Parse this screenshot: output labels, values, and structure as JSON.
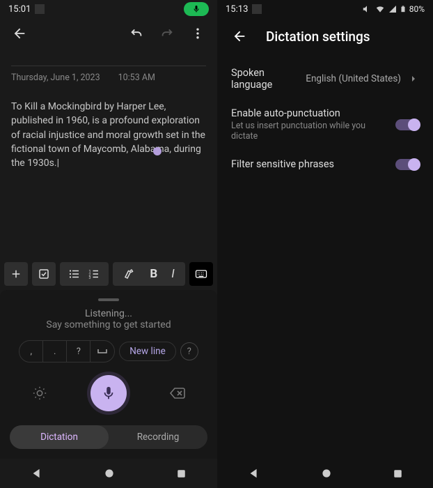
{
  "left": {
    "status_time": "15:01",
    "note_date": "Thursday, June 1, 2023",
    "note_time": "10:53 AM",
    "note_body": "To Kill a Mockingbird by Harper Lee, published in 1960, is a profound exploration of racial injustice and moral growth set in the fictional town of Maycomb, Alabama, during the 1930s.",
    "dictation": {
      "line1": "Listening...",
      "line2": "Say something to get started",
      "punct": [
        ",",
        ".",
        "?",
        "␣"
      ],
      "newline_label": "New line",
      "tabs": [
        "Dictation",
        "Recording"
      ],
      "active_tab": 0
    }
  },
  "right": {
    "status_time": "15:13",
    "battery": "80%",
    "title": "Dictation settings",
    "spoken_language": {
      "label": "Spoken language",
      "value": "English (United States)"
    },
    "auto_punct": {
      "label": "Enable auto-punctuation",
      "sub": "Let us insert punctuation while you dictate",
      "on": true
    },
    "filter": {
      "label": "Filter sensitive phrases",
      "on": true
    }
  }
}
